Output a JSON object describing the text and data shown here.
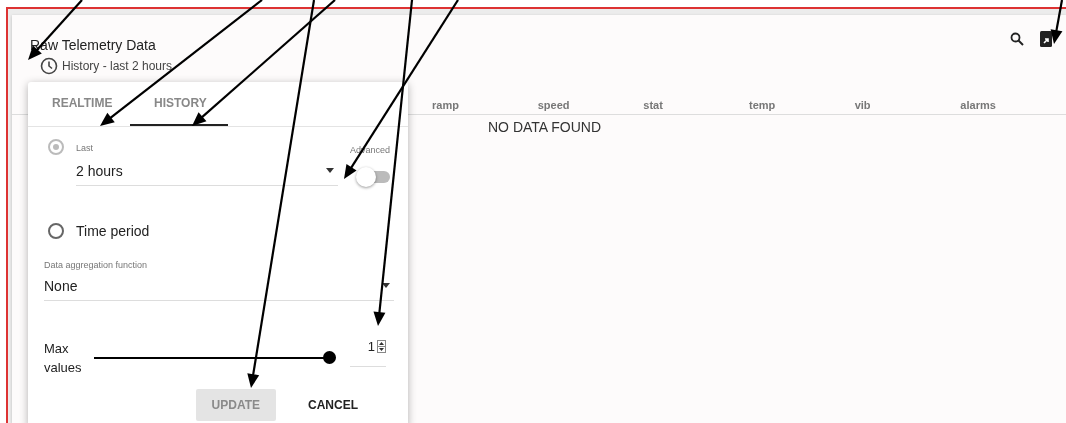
{
  "panel": {
    "title": "Raw Telemetry Data",
    "subtitle": "History - last 2 hours"
  },
  "table": {
    "columns": [
      "ramp",
      "speed",
      "stat",
      "temp",
      "vib",
      "alarms"
    ],
    "empty_message": "NO DATA FOUND"
  },
  "popup": {
    "tabs": [
      {
        "label": "REALTIME",
        "selected": false
      },
      {
        "label": "HISTORY",
        "selected": true
      }
    ],
    "options": [
      {
        "kind": "select",
        "selected": true,
        "disabled": true,
        "label": "Last",
        "value": "2 hours"
      },
      {
        "kind": "plain",
        "selected": false,
        "disabled": false,
        "label": "Time period"
      }
    ],
    "advanced": {
      "label": "Advanced",
      "on": false
    },
    "aggregation": {
      "label": "Data aggregation function",
      "value": "None"
    },
    "max_values": {
      "label": "Max values",
      "level": 1,
      "value": "1"
    },
    "buttons": [
      {
        "label": "UPDATE",
        "disabled": true
      },
      {
        "label": "CANCEL",
        "disabled": false
      }
    ]
  }
}
